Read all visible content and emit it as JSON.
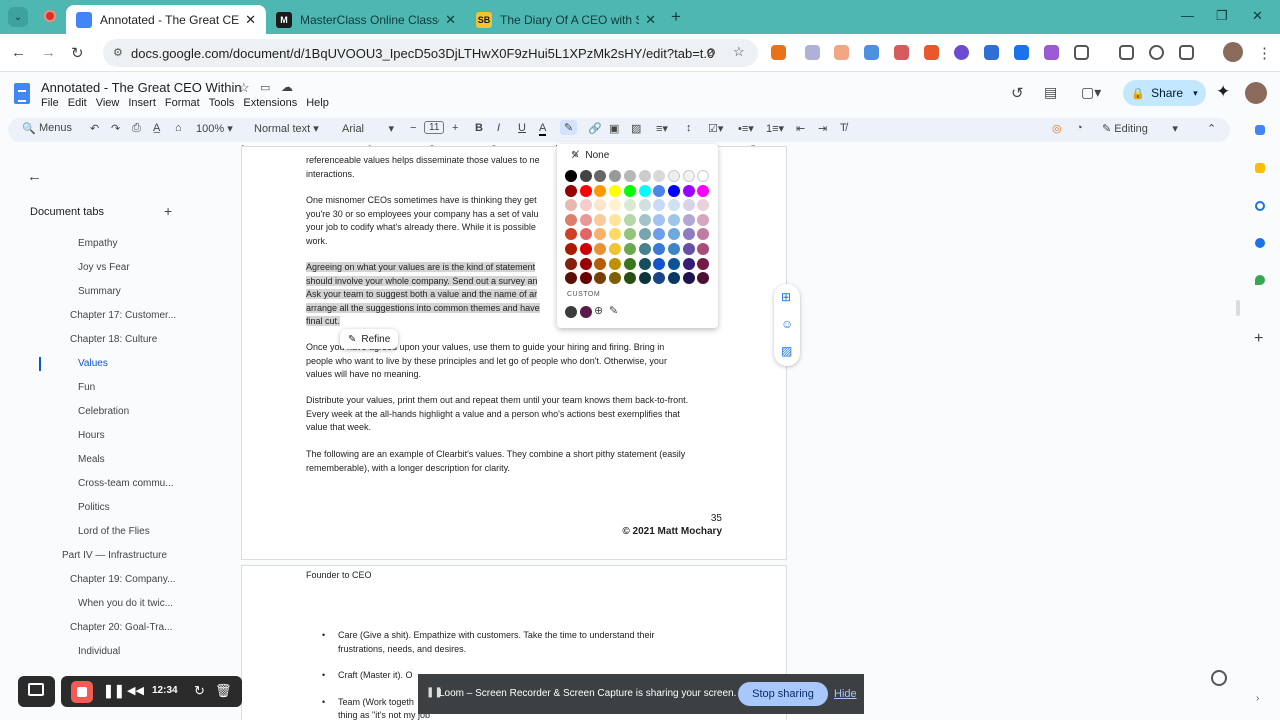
{
  "browser": {
    "tabs": [
      {
        "title": "Annotated - The Great CEO Wit",
        "color": "#4285f4",
        "letter": ""
      },
      {
        "title": "MasterClass Online Classes",
        "color": "#1b1b1b",
        "letter": "M"
      },
      {
        "title": "The Diary Of A CEO with Steven",
        "color": "#f4c430",
        "letter": "SB"
      }
    ],
    "url": "docs.google.com/document/d/1BqUVOOU3_IpecD5o3DjLTHwX0F9zHui5L1XPzMk2sHY/edit?tab=t.0"
  },
  "docs": {
    "title": "Annotated - The Great CEO Within",
    "menu": [
      "File",
      "Edit",
      "View",
      "Insert",
      "Format",
      "Tools",
      "Extensions",
      "Help"
    ],
    "share_label": "Share",
    "editing_label": "Editing"
  },
  "toolbar": {
    "menus_label": "Menus",
    "zoom": "100%",
    "style": "Normal text",
    "font": "Arial",
    "font_size": "11"
  },
  "ruler": [
    "1",
    "1",
    "2",
    "3",
    "4",
    "5",
    "6",
    "7"
  ],
  "sidebar": {
    "title": "Document tabs",
    "items": [
      {
        "label": "Empathy",
        "level": 3,
        "active": false
      },
      {
        "label": "Joy vs Fear",
        "level": 3,
        "active": false
      },
      {
        "label": "Summary",
        "level": 3,
        "active": false
      },
      {
        "label": "Chapter 17: Customer...",
        "level": 2,
        "active": false
      },
      {
        "label": "Chapter 18: Culture",
        "level": 2,
        "active": false
      },
      {
        "label": "Values",
        "level": 3,
        "active": true
      },
      {
        "label": "Fun",
        "level": 3,
        "active": false
      },
      {
        "label": "Celebration",
        "level": 3,
        "active": false
      },
      {
        "label": "Hours",
        "level": 3,
        "active": false
      },
      {
        "label": "Meals",
        "level": 3,
        "active": false
      },
      {
        "label": "Cross-team commu...",
        "level": 3,
        "active": false
      },
      {
        "label": "Politics",
        "level": 3,
        "active": false
      },
      {
        "label": "Lord of the Flies",
        "level": 3,
        "active": false
      },
      {
        "label": "Part IV — Infrastructure",
        "level": 1,
        "active": false
      },
      {
        "label": "Chapter 19: Company...",
        "level": 2,
        "active": false
      },
      {
        "label": "When you do it twic...",
        "level": 3,
        "active": false
      },
      {
        "label": "Chapter 20: Goal-Tra...",
        "level": 2,
        "active": false
      },
      {
        "label": "Individual",
        "level": 3,
        "active": false
      }
    ]
  },
  "page1": {
    "lines_a": [
      "referenceable values helps disseminate those values to ne",
      "interactions."
    ],
    "lines_b": [
      "One misnomer CEOs sometimes have is thinking they get",
      "you're 30 or so employees your company has a set of valu",
      "your job to codify what's already there. While it is possible",
      "work."
    ],
    "lines_c": [
      "Agreeing on what your values are is the kind of statement",
      "should involve your whole company. Send out a survey an",
      "Ask your team to suggest both a value and the name of ar",
      "arrange all the suggestions into common themes and have",
      "final cut."
    ],
    "refine_label": "Refine",
    "lines_d": [
      "Once you have agreed upon your values, use them to guide your hiring and firing. Bring in",
      "people who want to live by these principles and let go of people who don't. Otherwise, your",
      "values will have no meaning."
    ],
    "lines_e": [
      "Distribute your values, print them out and repeat them until your team knows them back-to-front.",
      "Every week at the all-hands highlight a value and a person who's actions best exemplifies that",
      "value that week."
    ],
    "lines_f": [
      "The following are an example of Clearbit's values. They combine a short pithy statement (easily",
      "rememberable), with a longer description for clarity."
    ],
    "page_number": "35",
    "copyright": "© 2021 Matt Mochary"
  },
  "page2": {
    "header": "Founder to CEO",
    "bullets": [
      [
        "Care (Give a shit). Empathize with customers. Take the time to understand their",
        "frustrations, needs, and desires."
      ],
      [
        "Craft (Master it). O",
        ""
      ],
      [
        "Team (Work togeth",
        "thing as \"it's not my job\""
      ]
    ]
  },
  "color_picker": {
    "none_label": "None",
    "custom_label": "CUSTOM",
    "grid": [
      [
        "#000000",
        "#434343",
        "#666666",
        "#999999",
        "#b7b7b7",
        "#cccccc",
        "#d9d9d9",
        "#efefef",
        "#f3f3f3",
        "#ffffff"
      ],
      [
        "#980000",
        "#ff0000",
        "#ff9900",
        "#ffff00",
        "#00ff00",
        "#00ffff",
        "#4a86e8",
        "#0000ff",
        "#9900ff",
        "#ff00ff"
      ],
      [
        "#e6b8af",
        "#f4cccc",
        "#fce5cd",
        "#fff2cc",
        "#d9ead3",
        "#d0e0e3",
        "#c9daf8",
        "#cfe2f3",
        "#d9d2e9",
        "#ead1dc"
      ],
      [
        "#dd7e6b",
        "#ea9999",
        "#f9cb9c",
        "#ffe599",
        "#b6d7a8",
        "#a2c4c9",
        "#a4c2f4",
        "#9fc5e8",
        "#b4a7d6",
        "#d5a6bd"
      ],
      [
        "#cc4125",
        "#e06666",
        "#f6b26b",
        "#ffd966",
        "#93c47d",
        "#76a5af",
        "#6d9eeb",
        "#6fa8dc",
        "#8e7cc3",
        "#c27ba0"
      ],
      [
        "#a61c00",
        "#cc0000",
        "#e69138",
        "#f1c232",
        "#6aa84f",
        "#45818e",
        "#3c78d8",
        "#3d85c6",
        "#674ea7",
        "#a64d79"
      ],
      [
        "#85200c",
        "#990000",
        "#b45f06",
        "#bf9000",
        "#38761d",
        "#134f5c",
        "#1155cc",
        "#0b5394",
        "#351c75",
        "#741b47"
      ],
      [
        "#5b0f00",
        "#660000",
        "#783f04",
        "#7f6000",
        "#274e13",
        "#0c343d",
        "#1c4587",
        "#073763",
        "#20124d",
        "#4c1130"
      ]
    ],
    "custom": [
      "#3c3c3c",
      "#5b1a4a"
    ]
  },
  "recorder": {
    "time": "12:34"
  },
  "loom": {
    "message": "Loom – Screen Recorder & Screen Capture is sharing your screen.",
    "stop_label": "Stop sharing",
    "hide_label": "Hide"
  }
}
